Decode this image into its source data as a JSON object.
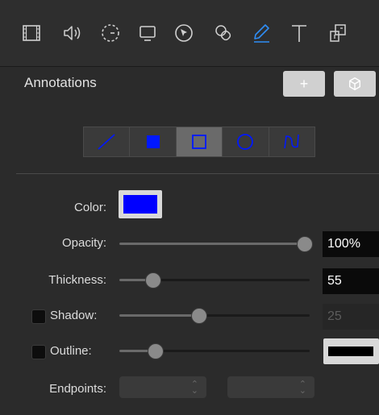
{
  "toolbar": {
    "icons": [
      "film-icon",
      "speaker-icon",
      "timer-icon",
      "screen-icon",
      "cursor-icon",
      "shapes-icon",
      "pencil-icon",
      "text-icon",
      "stamp-icon"
    ],
    "active_icon": "pencil-icon",
    "active_color": "#2f8df5"
  },
  "panel": {
    "title": "Annotations",
    "add_button_label": "+",
    "cube_button_icon": "cube-icon"
  },
  "shapes": {
    "items": [
      "line-icon",
      "filled-rectangle-icon",
      "rectangle-outline-icon",
      "circle-icon",
      "freehand-icon"
    ],
    "selected_index": 2,
    "shape_color": "#0018ff"
  },
  "fields": {
    "color_label": "Color:",
    "color_value": "#0000ff",
    "opacity_label": "Opacity:",
    "opacity_value": "100%",
    "opacity_level": 1.0,
    "thickness_label": "Thickness:",
    "thickness_value": "55",
    "thickness_level": 0.18,
    "shadow_label": "Shadow:",
    "shadow_value": "25",
    "shadow_level": 0.4,
    "shadow_checked": false,
    "outline_label": "Outline:",
    "outline_level": 0.19,
    "outline_checked": false,
    "outline_color": "#000000",
    "endpoints_label": "Endpoints:"
  }
}
